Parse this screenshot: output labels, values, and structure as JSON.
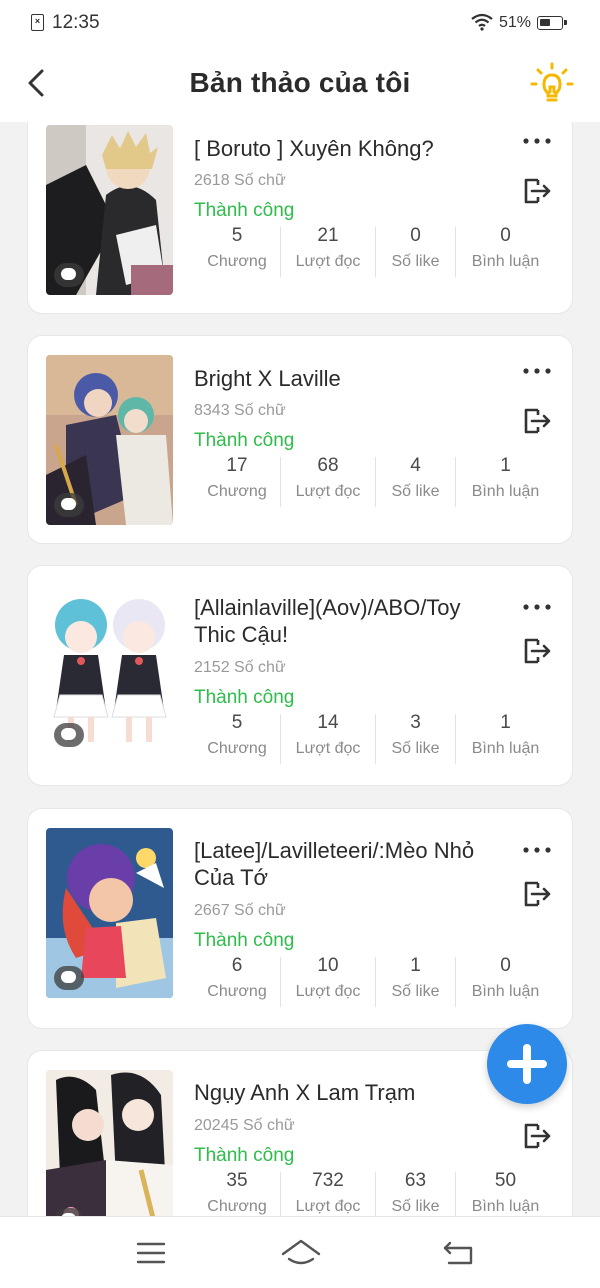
{
  "status_bar": {
    "time": "12:35",
    "battery": "51%",
    "battery_level": 0.51
  },
  "header": {
    "title": "Bản thảo của tôi"
  },
  "stat_labels": {
    "chapters": "Chương",
    "reads": "Lượt đọc",
    "likes": "Số like",
    "comments": "Bình luận"
  },
  "stories": [
    {
      "title": "[ Boruto ] Xuyên Không?",
      "words": "2618 Số chữ",
      "status": "Thành công",
      "chapters": "5",
      "reads": "21",
      "likes": "0",
      "comments": "0"
    },
    {
      "title": "Bright X Laville",
      "words": "8343 Số chữ",
      "status": "Thành công",
      "chapters": "17",
      "reads": "68",
      "likes": "4",
      "comments": "1"
    },
    {
      "title": "[Allainlaville](Aov)/ABO/Toy Thic Cậu!",
      "words": "2152 Số chữ",
      "status": "Thành công",
      "chapters": "5",
      "reads": "14",
      "likes": "3",
      "comments": "1"
    },
    {
      "title": "[Latee]/Lavilleteeri/:Mèo Nhỏ Của Tớ",
      "words": "2667 Số chữ",
      "status": "Thành công",
      "chapters": "6",
      "reads": "10",
      "likes": "1",
      "comments": "0"
    },
    {
      "title": "Ngụy Anh X Lam Trạm",
      "words": "20245 Số chữ",
      "status": "Thành công",
      "chapters": "35",
      "reads": "732",
      "likes": "63",
      "comments": "50"
    }
  ],
  "colors": {
    "accent": "#2d8ae8",
    "success": "#2ebd4a",
    "bulb": "#f5b800"
  },
  "icons": [
    "back-arrow-icon",
    "lightbulb-icon",
    "more-dots-icon",
    "export-icon",
    "comment-bubble-icon",
    "plus-icon",
    "menu-icon",
    "home-icon",
    "back-nav-icon"
  ]
}
